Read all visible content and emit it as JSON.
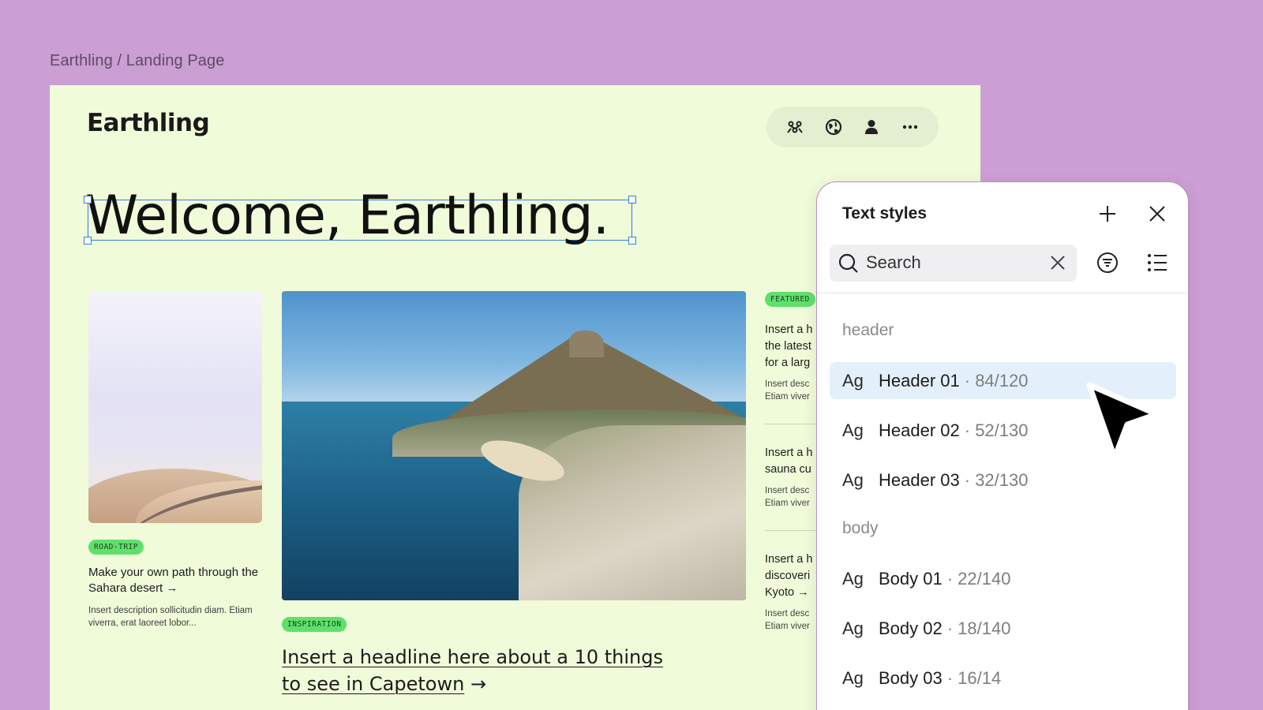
{
  "breadcrumb": "Earthling / Landing Page",
  "site": {
    "logo": "Earthling",
    "nav_icons": [
      "team-icon",
      "globe-icon",
      "user-icon",
      "more-icon"
    ],
    "hero_title": "Welcome, Earthling.",
    "cards": {
      "left": {
        "tag": "ROAD-TRIP",
        "title": "Make your own path through the Sahara desert →",
        "desc": "Insert description sollicitudin diam. Etiam viverra, erat laoreet lobor..."
      },
      "center": {
        "tag": "INSPIRATION",
        "headline_line1": "Insert a headline here about a 10 things",
        "headline_line2": "to see in Capetown",
        "arrow": "→"
      },
      "right": {
        "tag": "FEATURED",
        "items": [
          {
            "title": "Insert a h the latest for a larg",
            "desc": "Insert desc Etiam viver"
          },
          {
            "title": "Insert a h sauna cu",
            "desc": "Insert desc Etiam viver"
          },
          {
            "title": "Insert a h discoveri Kyoto →",
            "desc": "Insert desc Etiam viver"
          }
        ]
      }
    }
  },
  "panel": {
    "title": "Text styles",
    "search_placeholder": "Search",
    "groups": [
      {
        "label": "header",
        "styles": [
          {
            "ag": "Ag",
            "name": "Header 01",
            "meta": "· 84/120",
            "selected": true
          },
          {
            "ag": "Ag",
            "name": "Header 02",
            "meta": "· 52/130",
            "selected": false
          },
          {
            "ag": "Ag",
            "name": "Header 03",
            "meta": "· 32/130",
            "selected": false
          }
        ]
      },
      {
        "label": "body",
        "styles": [
          {
            "ag": "Ag",
            "name": "Body 01",
            "meta": "· 22/140",
            "selected": false
          },
          {
            "ag": "Ag",
            "name": "Body 02",
            "meta": "· 18/140",
            "selected": false
          },
          {
            "ag": "Ag",
            "name": "Body 03",
            "meta": "· 16/14",
            "selected": false
          }
        ]
      }
    ]
  },
  "colors": {
    "background": "#cb9fd3",
    "frame": "#f0fbd9",
    "tag_green": "#5fe06d",
    "selection_blue": "#2f7ee6",
    "row_selected": "#e3f0fb"
  }
}
